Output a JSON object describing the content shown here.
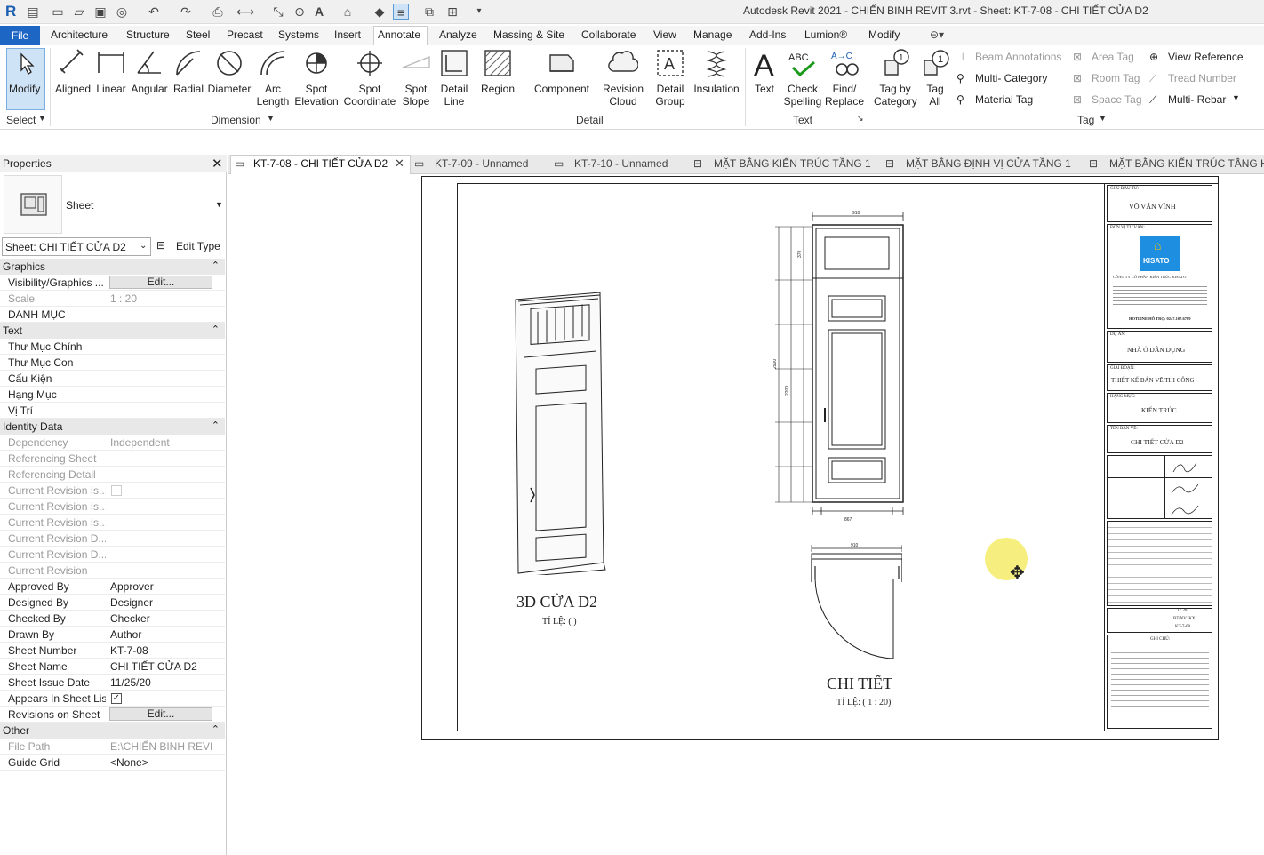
{
  "app": {
    "title": "Autodesk Revit 2021 - CHIẾN BINH REVIT 3.rvt - Sheet: KT-7-08 - CHI TIẾT CỬA D2",
    "logo": "R"
  },
  "menu": {
    "file": "File",
    "tabs": [
      "Architecture",
      "Structure",
      "Steel",
      "Precast",
      "Systems",
      "Insert",
      "Annotate",
      "Analyze",
      "Massing & Site",
      "Collaborate",
      "View",
      "Manage",
      "Add-Ins",
      "Lumion®",
      "Modify"
    ],
    "active": "Annotate"
  },
  "ribbon": {
    "modify": "Modify",
    "select_label": "Select",
    "dimension": {
      "tools": [
        "Aligned",
        "Linear",
        "Angular",
        "Radial",
        "Diameter",
        "Arc Length",
        "Spot Elevation",
        "Spot Coordinate",
        "Spot Slope"
      ],
      "label": "Dimension"
    },
    "detail": {
      "tools": [
        "Detail Line",
        "Region",
        "Component",
        "Revision Cloud",
        "Detail Group",
        "Insulation"
      ],
      "label": "Detail"
    },
    "text": {
      "tools": [
        "Text",
        "Check Spelling",
        "Find/ Replace"
      ],
      "label": "Text"
    },
    "tag": {
      "tools": [
        "Tag by Category",
        "Tag All"
      ],
      "small": [
        "Beam Annotations",
        "Multi- Category",
        "Material Tag",
        "Area Tag",
        "Room Tag",
        "Space Tag",
        "View Reference",
        "Tread Number",
        "Multi- Rebar"
      ],
      "label": "Tag"
    }
  },
  "properties": {
    "title": "Properties",
    "type_name": "Sheet",
    "selector": "Sheet: CHI TIẾT CỬA D2",
    "edit_type": "Edit Type",
    "edit_btn": "Edit...",
    "sections": {
      "graphics": "Graphics",
      "text": "Text",
      "identity": "Identity Data",
      "other": "Other"
    },
    "graphics_rows": [
      {
        "k": "Visibility/Graphics ...",
        "v": ""
      },
      {
        "k": "Scale",
        "v": "1 : 20"
      },
      {
        "k": "DANH MỤC",
        "v": ""
      }
    ],
    "text_rows": [
      {
        "k": "Thư Mục Chính",
        "v": ""
      },
      {
        "k": "Thư Mục Con",
        "v": ""
      },
      {
        "k": "Cấu Kiện",
        "v": ""
      },
      {
        "k": "Hạng Mục",
        "v": ""
      },
      {
        "k": "Vị Trí",
        "v": ""
      }
    ],
    "identity_rows": [
      {
        "k": "Dependency",
        "v": "Independent"
      },
      {
        "k": "Referencing Sheet",
        "v": ""
      },
      {
        "k": "Referencing Detail",
        "v": ""
      },
      {
        "k": "Current Revision Is...",
        "v": ""
      },
      {
        "k": "Current Revision Is...",
        "v": ""
      },
      {
        "k": "Current Revision Is...",
        "v": ""
      },
      {
        "k": "Current Revision D...",
        "v": ""
      },
      {
        "k": "Current Revision D...",
        "v": ""
      },
      {
        "k": "Current Revision",
        "v": ""
      },
      {
        "k": "Approved By",
        "v": "Approver"
      },
      {
        "k": "Designed By",
        "v": "Designer"
      },
      {
        "k": "Checked By",
        "v": "Checker"
      },
      {
        "k": "Drawn By",
        "v": "Author"
      },
      {
        "k": "Sheet Number",
        "v": "KT-7-08"
      },
      {
        "k": "Sheet Name",
        "v": "CHI TIẾT CỬA D2"
      },
      {
        "k": "Sheet Issue Date",
        "v": "11/25/20"
      },
      {
        "k": "Appears In Sheet List",
        "v": ""
      },
      {
        "k": "Revisions on Sheet",
        "v": ""
      }
    ],
    "other_rows": [
      {
        "k": "File Path",
        "v": "E:\\CHIẾN BINH REVI..."
      },
      {
        "k": "Guide Grid",
        "v": "<None>"
      }
    ]
  },
  "view_tabs": [
    "KT-7-08 - CHI TIẾT CỬA D2",
    "KT-7-09 - Unnamed",
    "KT-7-10 - Unnamed",
    "MẶT BẰNG KIẾN TRÚC TẦNG 1",
    "MẶT BẰNG ĐỊNH VỊ CỬA TẦNG 1",
    "MẶT BẰNG KIẾN TRÚC TẦNG HẦ"
  ],
  "sheet": {
    "view1_title": "3D CỬA D2",
    "view1_scale": "TỈ LỆ: ( )",
    "view2_title": "CHI TIẾT",
    "view2_scale": "TỈ LỆ: ( 1 : 20)",
    "titleblock": {
      "owner_label": "CHỦ ĐẦU TƯ:",
      "owner": "VÕ VĂN VĨNH",
      "consultant_label": "ĐƠN VỊ TƯ VẤN:",
      "company": "CÔNG TY CỔ PHẦN KIẾN TRÚC KISATO",
      "hotline": "HOTLINE HỖ TRỢ: 0247.107.6789",
      "project_label": "DỰ ÁN:",
      "project": "NHÀ Ở DÂN DỤNG",
      "phase_label": "GIAI ĐOẠN:",
      "phase": "THIẾT KẾ BẢN VẼ THI CÔNG",
      "item_label": "HẠNG MỤC:",
      "item": "KIẾN TRÚC",
      "drawing_label": "TÊN BẢN VẼ:",
      "drawing": "CHI TIẾT CỬA D2",
      "scale": "1 : 20",
      "code": "BT-NV1KX",
      "sheet_no": "KT-7-08",
      "notes_label": "GHI CHÚ:"
    }
  }
}
